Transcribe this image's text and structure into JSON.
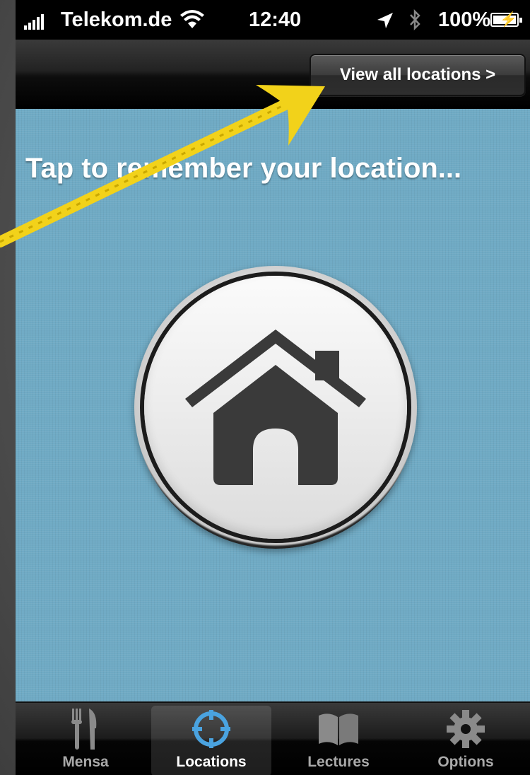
{
  "status_bar": {
    "carrier": "Telekom.de",
    "time": "12:40",
    "battery": "100%",
    "battery_level": 1.0,
    "icons": [
      "signal-bars-icon",
      "wifi-icon",
      "location-arrow-icon",
      "bluetooth-icon",
      "battery-charging-icon"
    ]
  },
  "nav_bar": {
    "view_all_label": "View all locations  >"
  },
  "content": {
    "prompt": "Tap to remember your location...",
    "home_button_icon": "house-icon"
  },
  "tab_bar": {
    "items": [
      {
        "label": "Mensa",
        "icon": "fork-knife-icon",
        "active": false
      },
      {
        "label": "Locations",
        "icon": "crosshair-icon",
        "active": true
      },
      {
        "label": "Lectures",
        "icon": "open-book-icon",
        "active": false
      },
      {
        "label": "Options",
        "icon": "gear-icon",
        "active": false
      }
    ]
  },
  "colors": {
    "content_background": "#6faac4",
    "annotation_arrow": "#f2d21a",
    "active_tab_icon": "#4aa3e0"
  }
}
